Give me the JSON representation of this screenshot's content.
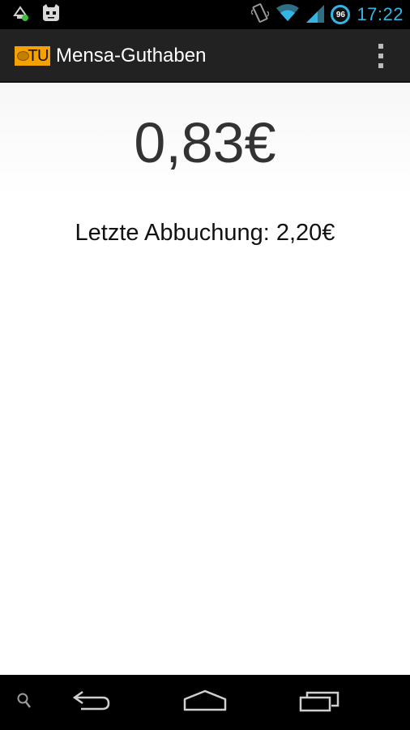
{
  "status_bar": {
    "time": "17:22",
    "battery_level": "96",
    "icons": [
      "usb-debug-icon",
      "cyanogen-icon",
      "vibrate-icon",
      "wifi-icon",
      "signal-icon",
      "battery-icon"
    ],
    "accent_color": "#33b5e5"
  },
  "action_bar": {
    "logo_text": "TU",
    "title": "Mensa-Guthaben",
    "logo_color": "#f5a100"
  },
  "main": {
    "balance": "0,83€",
    "last_debit": "Letzte Abbuchung: 2,20€"
  },
  "nav_bar": {
    "buttons": [
      "search-icon",
      "back-icon",
      "home-icon",
      "recent-apps-icon"
    ]
  }
}
